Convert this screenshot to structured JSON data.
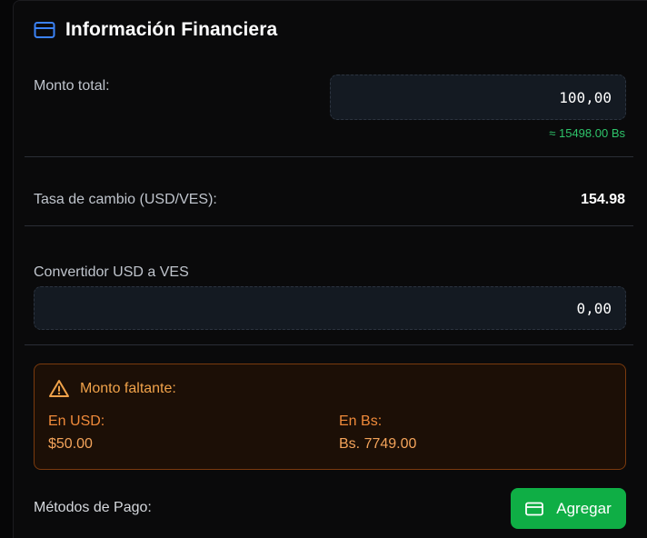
{
  "section": {
    "title": "Información Financiera",
    "icon": "credit-card-icon",
    "accent": "#3b82f6"
  },
  "total": {
    "label": "Monto total:",
    "value": "100,00",
    "converted": "≈ 15498.00 Bs"
  },
  "rate": {
    "label": "Tasa de cambio (USD/VES):",
    "value": "154.98"
  },
  "converter": {
    "label": "Convertidor USD a VES",
    "value": "0,00"
  },
  "missing": {
    "icon": "warning-triangle-icon",
    "title": "Monto faltante:",
    "usd_label": "En USD:",
    "usd_value": "$50.00",
    "bs_label": "En Bs:",
    "bs_value": "Bs. 7749.00"
  },
  "payments": {
    "label": "Métodos de Pago:",
    "add_label": "Agregar",
    "add_icon": "credit-card-icon",
    "add_color": "#0fae45"
  }
}
